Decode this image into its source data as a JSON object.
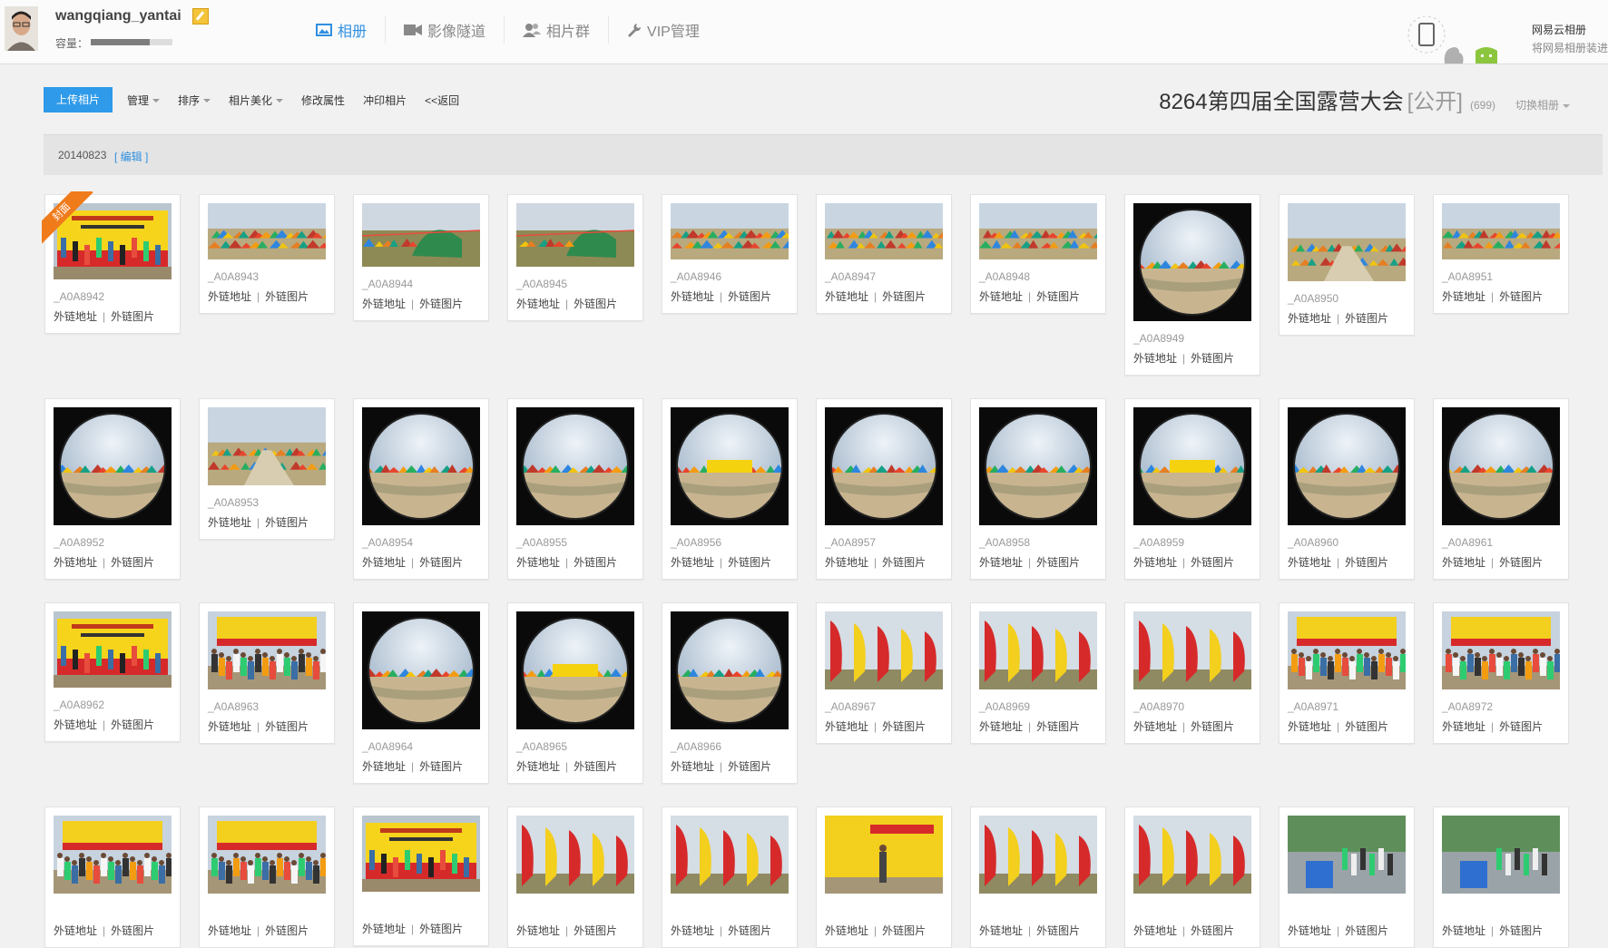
{
  "user": {
    "name": "wangqiang_yantai",
    "capacity_label": "容量：",
    "capacity_used": 0.72
  },
  "nav": {
    "items": [
      {
        "label": "相册",
        "icon": "photo-icon",
        "active": true
      },
      {
        "label": "影像隧道",
        "icon": "video-camera-icon",
        "active": false
      },
      {
        "label": "相片群",
        "icon": "group-icon",
        "active": false
      },
      {
        "label": "VIP管理",
        "icon": "wrench-icon",
        "active": false
      }
    ]
  },
  "mobile_promo": {
    "title": "网易云相册",
    "subtitle": "将网易相册装进"
  },
  "toolbar": {
    "upload": "上传相片",
    "manage": "管理",
    "sort": "排序",
    "beautify": "相片美化",
    "edit_props": "修改属性",
    "print": "冲印相片",
    "back": "<<返回"
  },
  "album": {
    "title": "8264第四届全国露营大会",
    "visibility": "[公开]",
    "count": "(699)",
    "switch": "切换相册"
  },
  "date_group": {
    "date": "20140823",
    "edit": "[ 编辑 ]"
  },
  "photo_actions": {
    "link_url": "外链地址",
    "link_image": "外链图片",
    "separator": "|"
  },
  "cover_badge": "封面",
  "colors": {
    "accent": "#2f9ae9",
    "cover_ribbon": "#f07b1b"
  },
  "photos": [
    {
      "name": "_A0A8942",
      "kind": "banner",
      "cover": true
    },
    {
      "name": "_A0A8943",
      "kind": "tents"
    },
    {
      "name": "_A0A8944",
      "kind": "greentent"
    },
    {
      "name": "_A0A8945",
      "kind": "greentent"
    },
    {
      "name": "_A0A8946",
      "kind": "tents"
    },
    {
      "name": "_A0A8947",
      "kind": "tents"
    },
    {
      "name": "_A0A8948",
      "kind": "tents"
    },
    {
      "name": "_A0A8949",
      "kind": "fisheye"
    },
    {
      "name": "_A0A8950",
      "kind": "camp"
    },
    {
      "name": "_A0A8951",
      "kind": "tents"
    },
    {
      "name": "_A0A8952",
      "kind": "fisheye"
    },
    {
      "name": "_A0A8953",
      "kind": "camp"
    },
    {
      "name": "_A0A8954",
      "kind": "fisheye"
    },
    {
      "name": "_A0A8955",
      "kind": "fisheye"
    },
    {
      "name": "_A0A8956",
      "kind": "fisheye"
    },
    {
      "name": "_A0A8957",
      "kind": "fisheye"
    },
    {
      "name": "_A0A8958",
      "kind": "fisheye"
    },
    {
      "name": "_A0A8959",
      "kind": "fisheye"
    },
    {
      "name": "_A0A8960",
      "kind": "fisheye"
    },
    {
      "name": "_A0A8961",
      "kind": "fisheye"
    },
    {
      "name": "_A0A8962",
      "kind": "banner"
    },
    {
      "name": "_A0A8963",
      "kind": "crowd"
    },
    {
      "name": "_A0A8964",
      "kind": "fisheye"
    },
    {
      "name": "_A0A8965",
      "kind": "fisheye"
    },
    {
      "name": "_A0A8966",
      "kind": "fisheye"
    },
    {
      "name": "_A0A8967",
      "kind": "flags"
    },
    {
      "name": "_A0A8969",
      "kind": "flags"
    },
    {
      "name": "_A0A8970",
      "kind": "flags"
    },
    {
      "name": "_A0A8971",
      "kind": "crowd"
    },
    {
      "name": "_A0A8972",
      "kind": "crowd"
    },
    {
      "name": "",
      "kind": "crowd"
    },
    {
      "name": "",
      "kind": "crowd"
    },
    {
      "name": "",
      "kind": "banner"
    },
    {
      "name": "",
      "kind": "flags"
    },
    {
      "name": "",
      "kind": "flags"
    },
    {
      "name": "",
      "kind": "stage"
    },
    {
      "name": "",
      "kind": "flags"
    },
    {
      "name": "",
      "kind": "flags"
    },
    {
      "name": "",
      "kind": "park"
    },
    {
      "name": "",
      "kind": "park"
    }
  ]
}
